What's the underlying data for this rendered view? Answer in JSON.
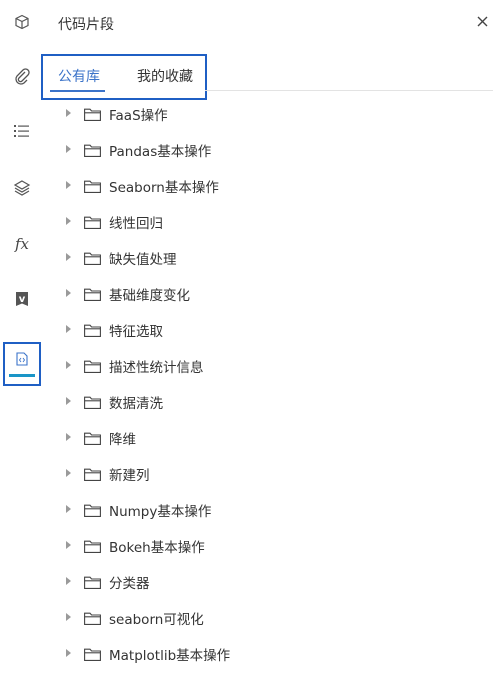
{
  "panel": {
    "title": "代码片段",
    "close_label": "×"
  },
  "tabs": [
    {
      "label": "公有库",
      "active": true
    },
    {
      "label": "我的收藏",
      "active": false
    }
  ],
  "rail": [
    {
      "icon": "cube-icon"
    },
    {
      "icon": "paperclip-icon"
    },
    {
      "icon": "list-icon"
    },
    {
      "icon": "layers-icon"
    },
    {
      "icon": "function-icon",
      "text": "fx"
    },
    {
      "icon": "variable-bookmark-icon",
      "text": "v"
    },
    {
      "icon": "code-snippet-icon",
      "active": true
    }
  ],
  "folders": [
    "FaaS操作",
    "Pandas基本操作",
    "Seaborn基本操作",
    "线性回归",
    "缺失值处理",
    "基础维度变化",
    "特征选取",
    "描述性统计信息",
    "数据清洗",
    "降维",
    "新建列",
    "Numpy基本操作",
    "Bokeh基本操作",
    "分类器",
    "seaborn可视化",
    "Matplotlib基本操作"
  ],
  "colors": {
    "accent": "#3b73c9",
    "highlight_border": "#1f5fc4",
    "active_bar": "#1a95c7"
  }
}
